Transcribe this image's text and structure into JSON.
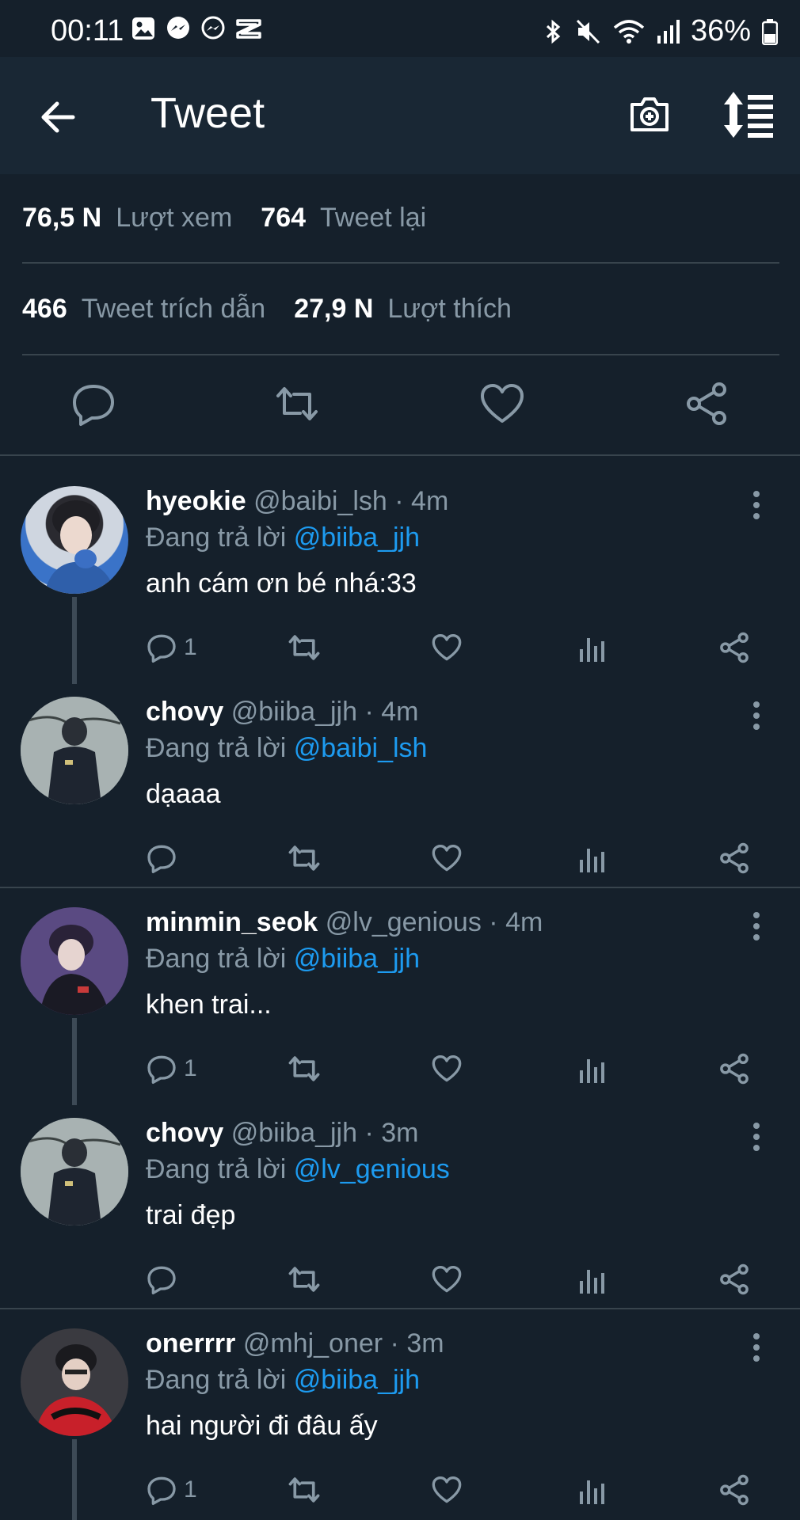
{
  "status_bar": {
    "time": "00:11",
    "battery": "36%",
    "left_icons": [
      "gallery-icon",
      "messenger-icon",
      "messenger-icon",
      "capcut-icon"
    ],
    "right_icons": [
      "bluetooth-icon",
      "mute-icon",
      "wifi-icon",
      "signal-icon",
      "battery-icon"
    ]
  },
  "header": {
    "title": "Tweet",
    "icons": [
      "back-arrow-icon",
      "camera-add-icon",
      "sort-icon"
    ]
  },
  "stats": {
    "views_count": "76,5 N",
    "views_label": "Lượt xem",
    "retweets_count": "764",
    "retweets_label": "Tweet lại",
    "quotes_count": "466",
    "quotes_label": "Tweet trích dẫn",
    "likes_count": "27,9 N",
    "likes_label": "Lượt thích"
  },
  "colors": {
    "background": "#15202b",
    "header_bg": "#192734",
    "muted_text": "#8899a6",
    "accent": "#1d9bf0",
    "divider": "#38444d"
  },
  "replies": [
    {
      "name": "hyeokie",
      "handle": "@baibi_lsh",
      "time": "4m",
      "replying_prefix": "Đang trả lời",
      "replying_to": "@biiba_jjh",
      "text": "anh cám ơn bé nhá:33",
      "reply_count": "1"
    },
    {
      "name": "chovy",
      "handle": "@biiba_jjh",
      "time": "4m",
      "replying_prefix": "Đang trả lời",
      "replying_to": "@baibi_lsh",
      "text": "dạaaa",
      "reply_count": ""
    },
    {
      "name": "minmin_seok",
      "handle": "@lv_genious",
      "time": "4m",
      "replying_prefix": "Đang trả lời",
      "replying_to": "@biiba_jjh",
      "text": "khen trai...",
      "reply_count": "1"
    },
    {
      "name": "chovy",
      "handle": "@biiba_jjh",
      "time": "3m",
      "replying_prefix": "Đang trả lời",
      "replying_to": "@lv_genious",
      "text": "trai đẹp",
      "reply_count": ""
    },
    {
      "name": "onerrrr",
      "handle": "@mhj_oner",
      "time": "3m",
      "replying_prefix": "Đang trả lời",
      "replying_to": "@biiba_jjh",
      "text": "hai người đi đâu ấy",
      "reply_count": "1"
    }
  ]
}
